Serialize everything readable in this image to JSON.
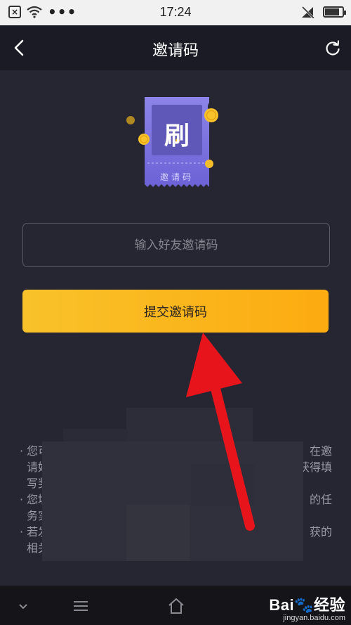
{
  "status_bar": {
    "time": "17:24",
    "dots": "•••",
    "battery_level": 0.85
  },
  "header": {
    "title": "邀请码"
  },
  "ticket": {
    "logo_char": "刷",
    "label": "邀请码"
  },
  "form": {
    "input_placeholder": "输入好友邀请码",
    "submit_label": "提交邀请码"
  },
  "notes": [
    {
      "line1": "· 您可",
      "line1_end": "在邀",
      "line2": "请好",
      "line2_end": "获得填",
      "line3": "写奖"
    },
    {
      "line1": "· 您填",
      "line1_end": "的任",
      "line2": "务实"
    },
    {
      "line1": "· 若发",
      "line1_end": "获的",
      "line2": "相关"
    }
  ],
  "watermark": {
    "main": "Bai🐾经验",
    "sub": "jingyan.baidu.com"
  },
  "colors": {
    "accent": "#fcb81a",
    "background": "#262633",
    "arrow": "#e8141b"
  }
}
